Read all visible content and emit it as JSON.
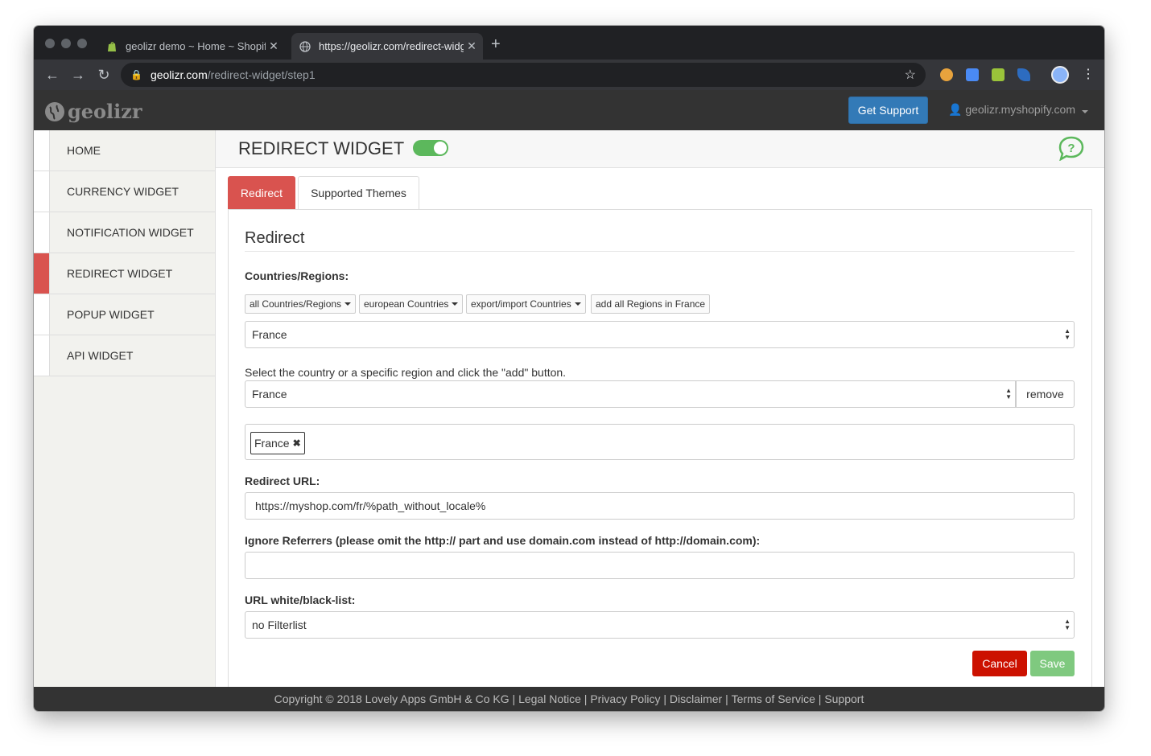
{
  "browser": {
    "tabs": [
      {
        "title": "geolizr demo ~ Home ~ Shopify",
        "favicon": "shopify-icon"
      },
      {
        "title": "https://geolizr.com/redirect-widget",
        "favicon": "globe-icon"
      }
    ],
    "address": {
      "host": "geolizr.com",
      "path": "/redirect-widget/step1"
    }
  },
  "header": {
    "logo_text": "geolizr",
    "support_button": "Get Support",
    "shop_dropdown": "geolizr.myshopify.com"
  },
  "sidebar": {
    "items": [
      {
        "label": "HOME"
      },
      {
        "label": "CURRENCY WIDGET"
      },
      {
        "label": "NOTIFICATION WIDGET"
      },
      {
        "label": "REDIRECT WIDGET"
      },
      {
        "label": "POPUP WIDGET"
      },
      {
        "label": "API WIDGET"
      }
    ],
    "active_index": 3
  },
  "page": {
    "title": "REDIRECT WIDGET",
    "enabled": true,
    "tabs": [
      "Redirect",
      "Supported Themes"
    ]
  },
  "form": {
    "heading": "Redirect",
    "countries_label": "Countries/Regions:",
    "chips": [
      "all Countries/Regions",
      "european Countries",
      "export/import Countries",
      "add all Regions in France"
    ],
    "country_select": "France",
    "help_text": "Select the country or a specific region and click the \"add\" button.",
    "region_select": "France",
    "remove_button": "remove",
    "selected_tags": [
      "France"
    ],
    "redirect_url_label": "Redirect URL:",
    "redirect_url_value": "https://myshop.com/fr/%path_without_locale%",
    "ignore_referrers_label": "Ignore Referrers (please omit the http:// part and use domain.com instead of http://domain.com):",
    "ignore_referrers_value": "",
    "filter_label": "URL white/black-list:",
    "filter_select": "no Filterlist",
    "cancel_button": "Cancel",
    "save_button": "Save"
  },
  "footer": {
    "copyright": "Copyright © 2018 Lovely Apps GmbH & Co KG",
    "links": [
      "Legal Notice",
      "Privacy Policy",
      "Disclaimer",
      "Terms of Service",
      "Support"
    ]
  },
  "colors": {
    "accent_red": "#d9534f",
    "primary_blue": "#337ab7",
    "toggle_green": "#5cb85c",
    "header_bg": "#333333"
  }
}
